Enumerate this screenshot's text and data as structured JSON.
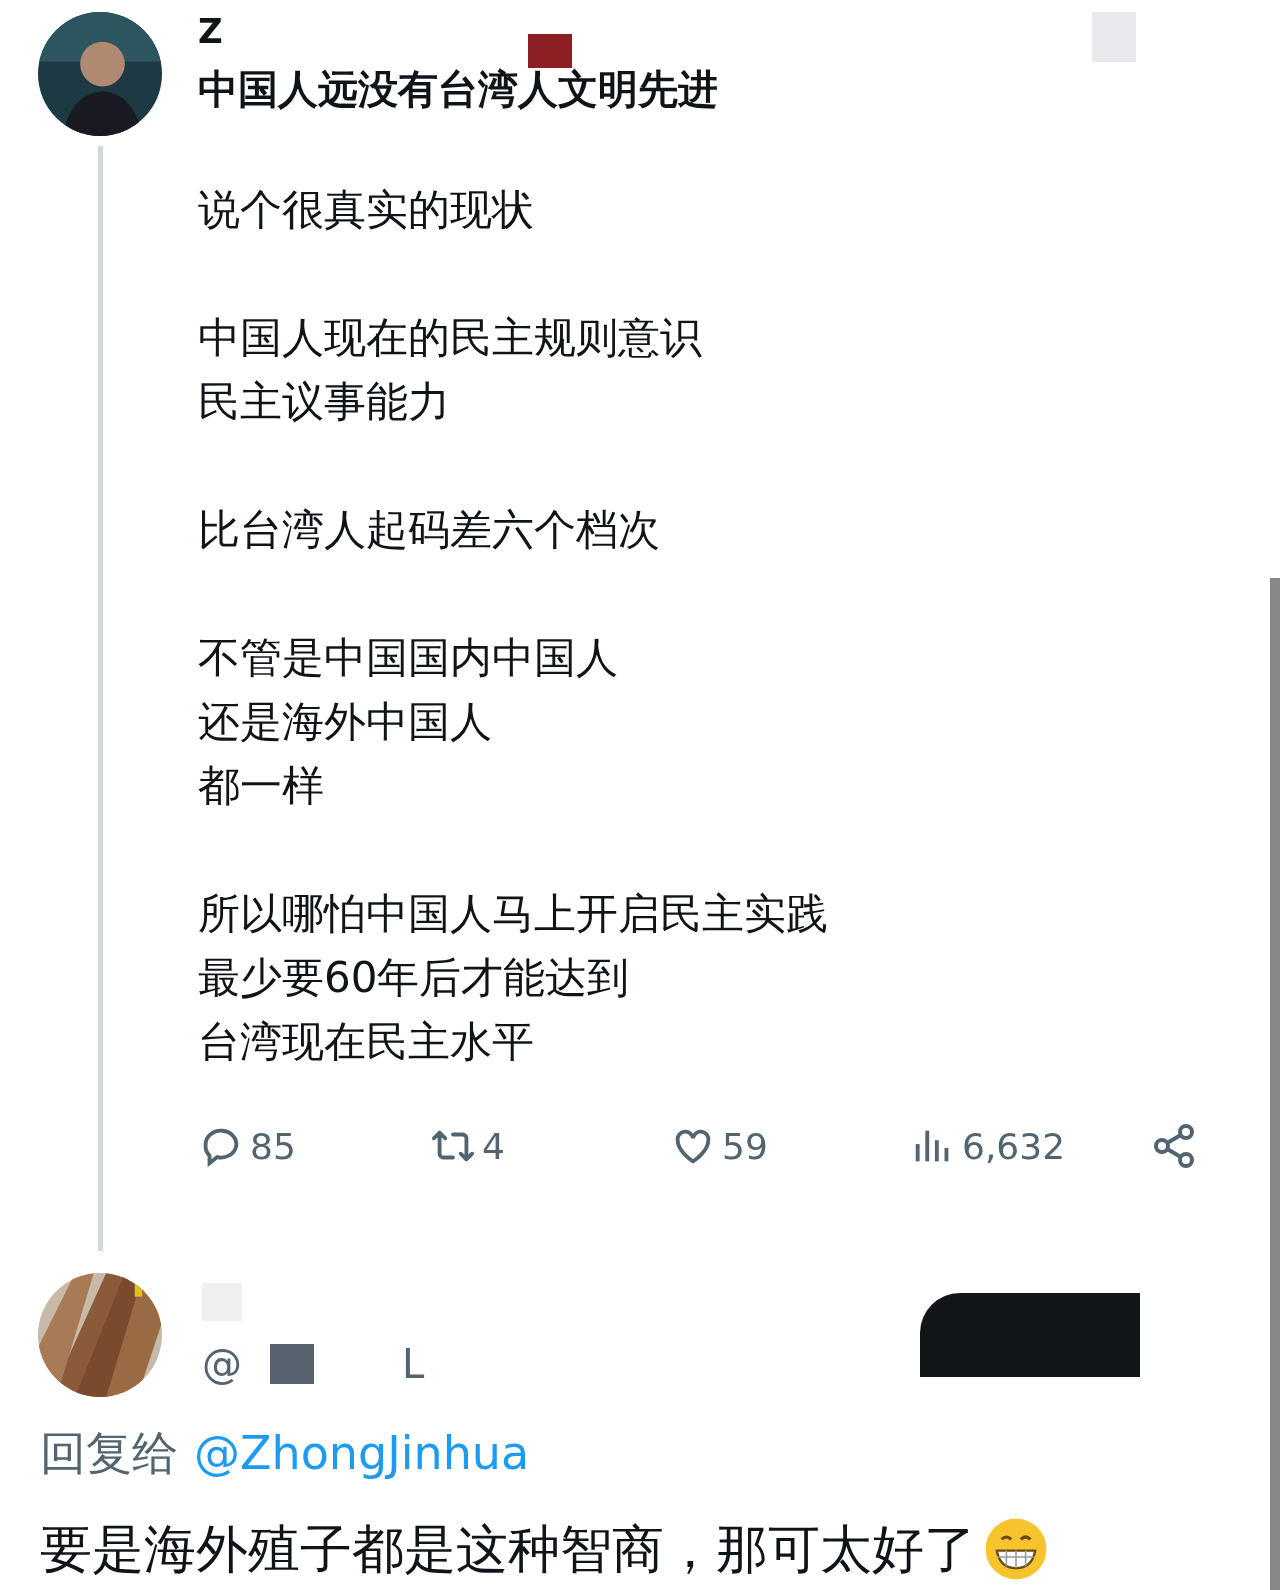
{
  "post": {
    "author": "Z",
    "title": "中国人远没有台湾人文明先进",
    "paragraphs": [
      [
        "说个很真实的现状"
      ],
      [
        "中国人现在的民主规则意识",
        "民主议事能力"
      ],
      [
        "比台湾人起码差六个档次"
      ],
      [
        "不管是中国国内中国人",
        "还是海外中国人",
        "都一样"
      ],
      [
        "所以哪怕中国人马上开启民主实践",
        "最少要60年后才能达到",
        "台湾现在民主水平"
      ]
    ],
    "stats": [
      {
        "kind": "reply",
        "count": "85"
      },
      {
        "kind": "repost",
        "count": "4"
      },
      {
        "kind": "like",
        "count": "59"
      },
      {
        "kind": "views",
        "count": "6,632"
      },
      {
        "kind": "share"
      }
    ]
  },
  "reply": {
    "handle_start": "@",
    "handle_end": "L",
    "reply_to_label": "回复给",
    "reply_to_handle": "@ZhongJinhua",
    "text": "要是海外殖子都是这种智商，那可太好了"
  }
}
